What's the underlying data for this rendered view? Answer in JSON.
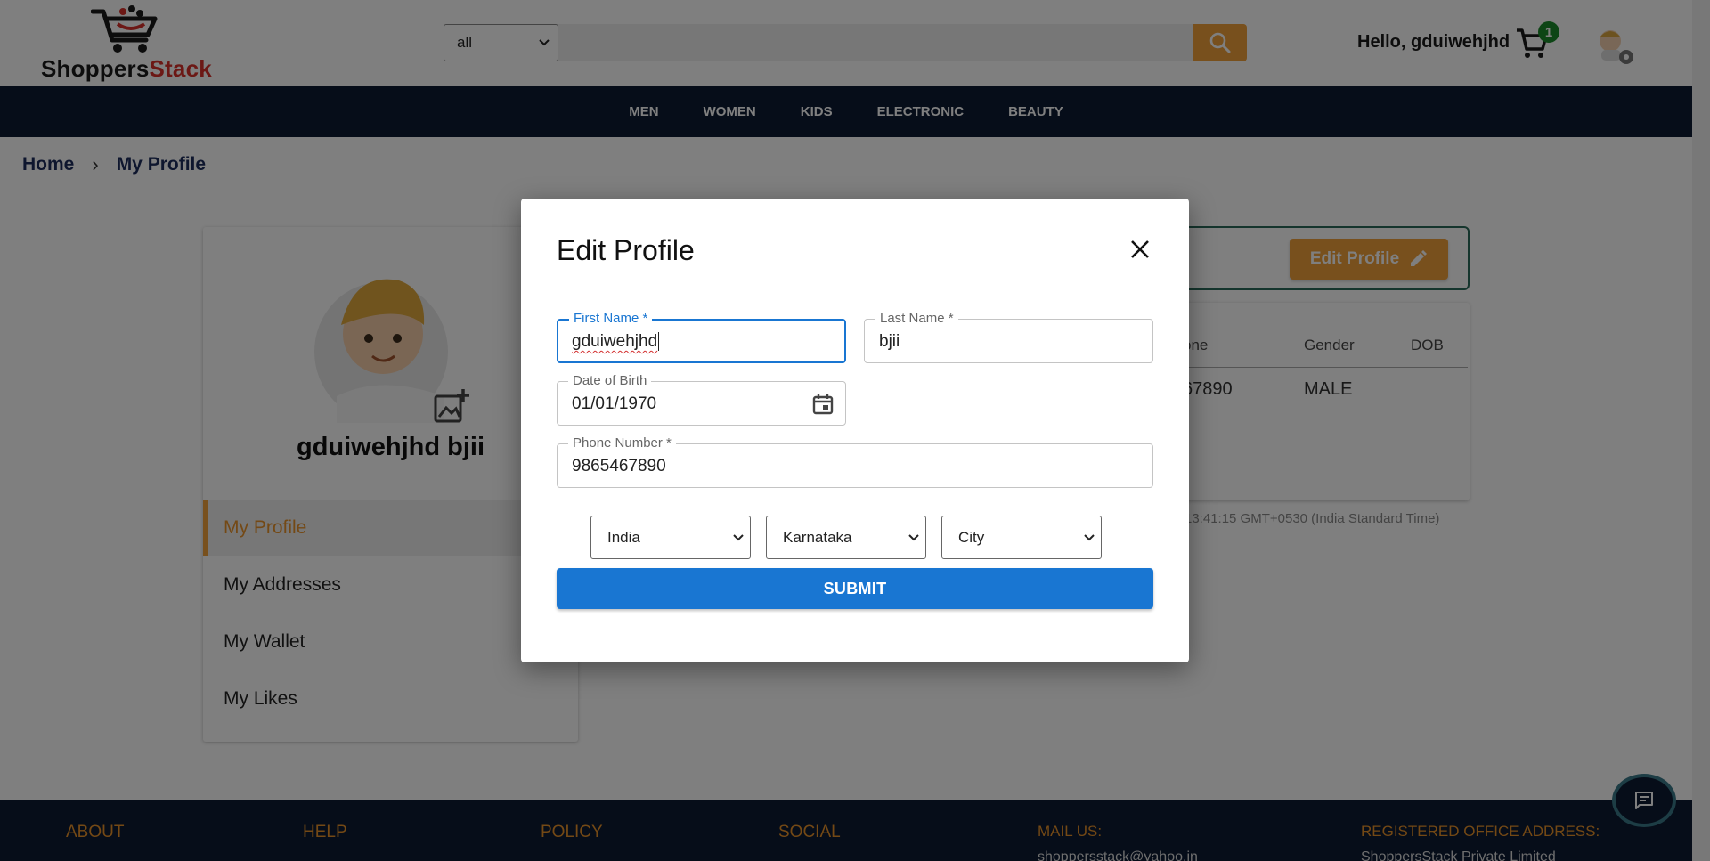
{
  "header": {
    "logo_part1": "Shoppers",
    "logo_part2": "Stack",
    "category_select": "all",
    "search_placeholder": "",
    "greeting": "Hello, gduiwehjhd",
    "cart_count": "1"
  },
  "nav": {
    "items": [
      "MEN",
      "WOMEN",
      "KIDS",
      "ELECTRONIC",
      "BEAUTY"
    ]
  },
  "breadcrumb": {
    "home": "Home",
    "separator": "›",
    "current": "My Profile"
  },
  "sidebar": {
    "name": "gduiwehjhd bjii",
    "items": [
      {
        "label": "My Profile",
        "active": true
      },
      {
        "label": "My Addresses",
        "active": false
      },
      {
        "label": "My Wallet",
        "active": false
      },
      {
        "label": "My Likes",
        "active": false
      }
    ]
  },
  "profile_panel": {
    "edit_button": "Edit Profile",
    "columns": [
      "one",
      "Gender",
      "DOB"
    ],
    "row": [
      "67890",
      "MALE",
      ""
    ],
    "timestamp": "13:41:15 GMT+0530 (India Standard Time)"
  },
  "footer": {
    "headings": [
      "ABOUT",
      "HELP",
      "POLICY",
      "SOCIAL",
      "MAIL US:",
      "REGISTERED OFFICE ADDRESS:"
    ],
    "mail": "shoppersstack@yahoo.in",
    "office": "ShoppersStack Private Limited"
  },
  "modal": {
    "title": "Edit Profile",
    "first_name_label": "First Name *",
    "first_name_value": "gduiwehjhd",
    "last_name_label": "Last Name *",
    "last_name_value": "bjii",
    "dob_label": "Date of Birth",
    "dob_value": "01/01/1970",
    "phone_label": "Phone Number *",
    "phone_value": "9865467890",
    "country": "India",
    "state": "Karnataka",
    "city": "City",
    "submit": "SUBMIT"
  },
  "colors": {
    "accent_orange": "#f0a03a",
    "nav_bg": "#0c1a33",
    "primary_blue": "#1976d2",
    "logo_red": "#d8302b"
  }
}
